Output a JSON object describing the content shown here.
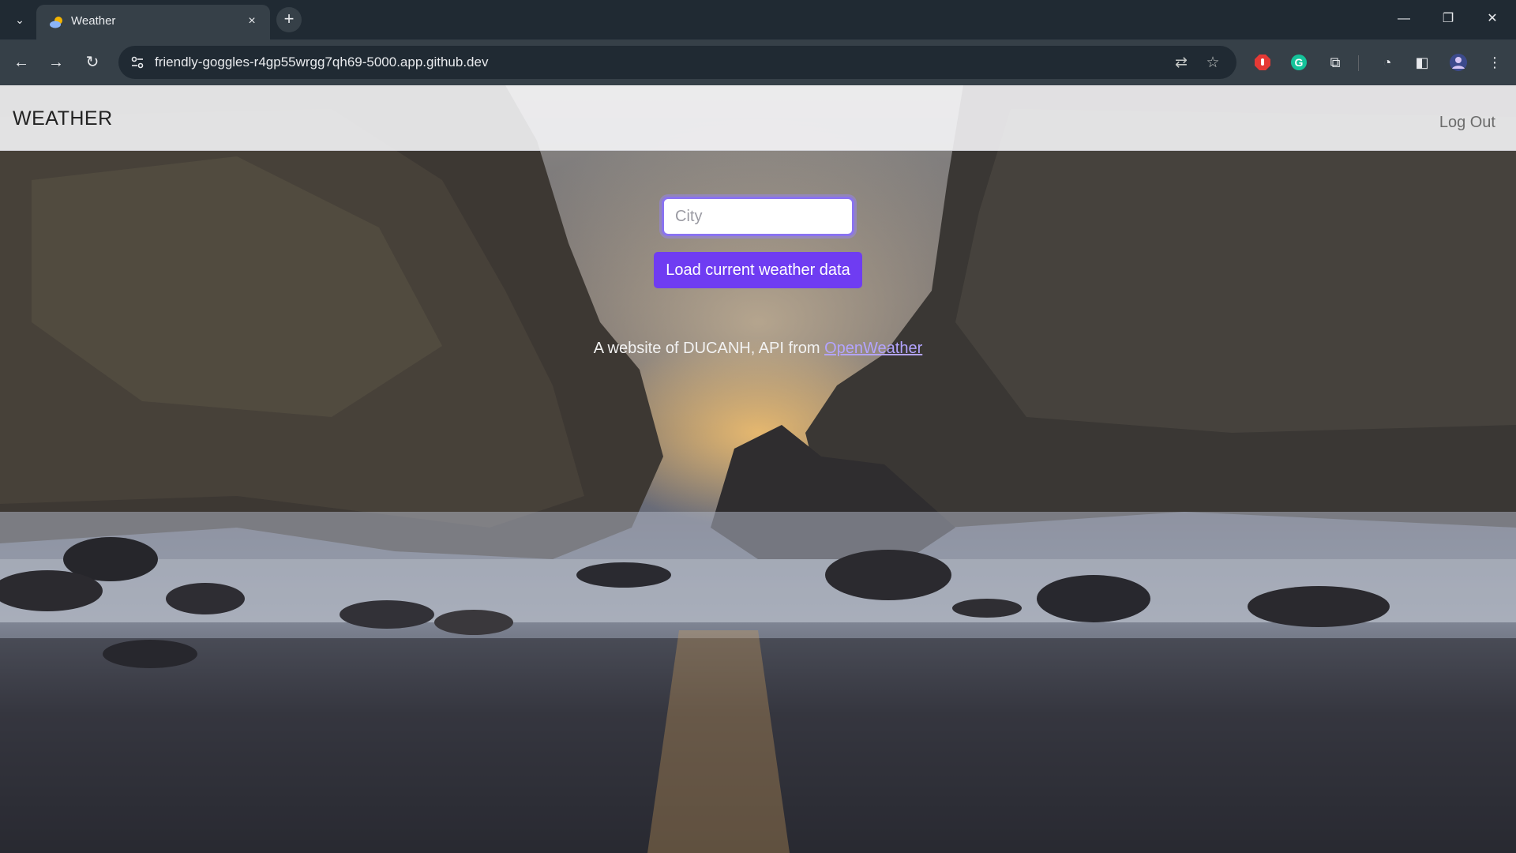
{
  "browser": {
    "tab_title": "Weather",
    "tab_close": "×",
    "new_tab": "+",
    "url": "friendly-goggles-r4gp55wrgg7qh69-5000.app.github.dev",
    "icons": [
      "tab-search-icon",
      "weather-favicon",
      "back-icon",
      "forward-icon",
      "reload-icon",
      "site-info-icon",
      "translate-icon",
      "bookmark-star-icon",
      "adblock-icon",
      "grammarly-icon",
      "extensions-icon",
      "performance-icon",
      "side-panel-icon",
      "profile-avatar-icon",
      "menu-icon",
      "minimize-icon",
      "restore-icon",
      "close-icon"
    ]
  },
  "navbar": {
    "brand": "WEATHER",
    "logout": "Log Out"
  },
  "form": {
    "city_placeholder": "City",
    "city_value": "",
    "submit_label": "Load current weather data"
  },
  "footer": {
    "credit_prefix": "A website of DUCANH, API from ",
    "credit_link": "OpenWeather"
  },
  "colors": {
    "accent": "#6f3cf2",
    "focus_ring": "#8a73f0",
    "link": "#b3a4ff"
  }
}
